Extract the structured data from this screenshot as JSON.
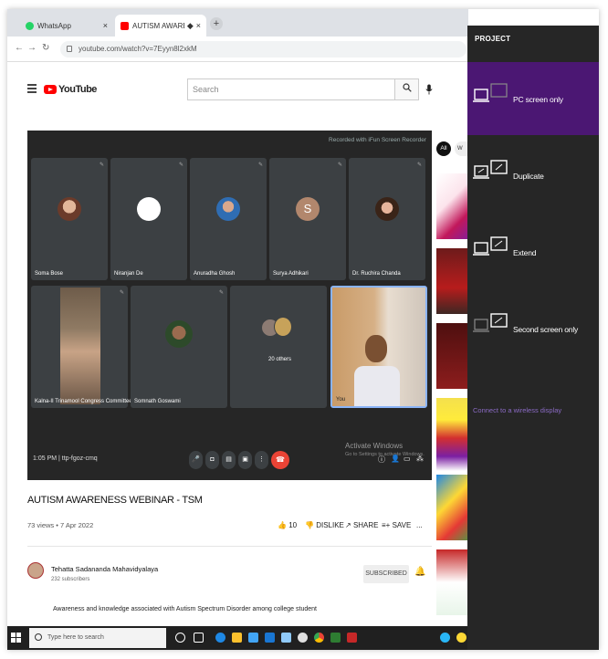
{
  "browser": {
    "tabs": [
      {
        "title": "WhatsApp",
        "favicon_color": "#25d366"
      },
      {
        "title": "AUTISM AWARENESS WEBIN",
        "favicon_color": "#ff0000"
      }
    ],
    "url": "youtube.com/watch?v=7Eyyn8l2xkM"
  },
  "youtube": {
    "logo": "YouTube",
    "search_placeholder": "Search"
  },
  "meet": {
    "recorder_text": "Recorded with iFun Screen Recorder",
    "participants": [
      {
        "name": "Soma Bose",
        "avatar": "photo"
      },
      {
        "name": "Niranjan De",
        "avatar": "blank"
      },
      {
        "name": "Anuradha Ghosh",
        "avatar": "photo"
      },
      {
        "name": "Surya Adhikari",
        "avatar": "letter",
        "letter": "S",
        "color": "#b2876d"
      },
      {
        "name": "Dr. Ruchira Chanda",
        "avatar": "photo"
      },
      {
        "name": "Kalna-II Trinamool Congress Committee",
        "avatar": "video"
      },
      {
        "name": "Somnath Goswami",
        "avatar": "photo"
      },
      {
        "name": "20 others",
        "avatar": "group"
      },
      {
        "name": "You",
        "avatar": "video"
      }
    ],
    "time": "1:05 PM",
    "meeting_code": "ttp-fgoz-cmq",
    "activate_title": "Activate Windows",
    "activate_sub": "Go to Settings to activate Windows."
  },
  "video": {
    "title": "AUTISM AWARENESS WEBINAR - TSM",
    "meta": "73 views • 7 Apr 2022",
    "likes": "10",
    "dislike_label": "DISLIKE",
    "share_label": "SHARE",
    "save_label": "SAVE",
    "more_label": "..."
  },
  "channel": {
    "name": "Tehatta Sadananda Mahavidyalaya",
    "subs": "232 subscribers",
    "subscribe_label": "SUBSCRIBED",
    "description": "Awareness and knowledge associated with Autism Spectrum Disorder among college  student"
  },
  "sidebar": {
    "chip_all": "All",
    "chip_next": "W"
  },
  "taskbar": {
    "search_placeholder": "Type here to search"
  },
  "project_panel": {
    "heading": "PROJECT",
    "options": [
      {
        "label": "PC screen only",
        "selected": true
      },
      {
        "label": "Duplicate",
        "selected": false
      },
      {
        "label": "Extend",
        "selected": false
      },
      {
        "label": "Second screen only",
        "selected": false
      }
    ],
    "connect_link": "Connect to a wireless display"
  }
}
